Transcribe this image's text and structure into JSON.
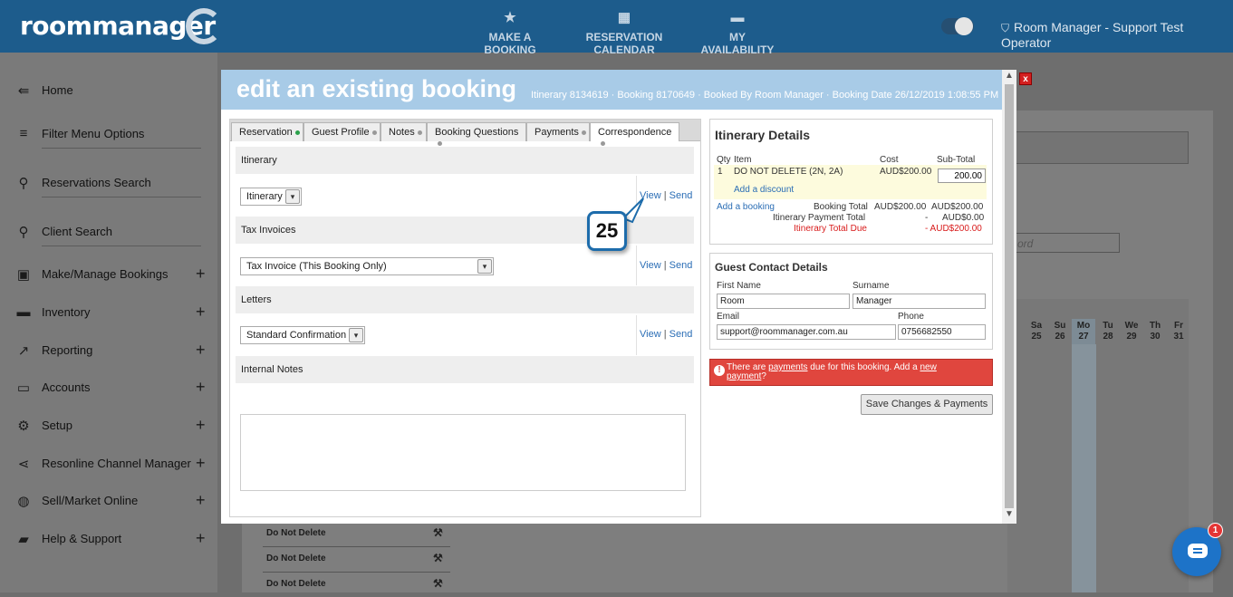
{
  "header": {
    "logo_text": "roommanager",
    "nav": [
      {
        "icon": "star-icon",
        "label": "MAKE A BOOKING"
      },
      {
        "icon": "calendar-icon",
        "label": "RESERVATION CALENDAR"
      },
      {
        "icon": "bed-icon",
        "label": "MY AVAILABILITY"
      }
    ],
    "user_name": "Room Manager - Support Test Operator"
  },
  "sidebar": {
    "items": [
      {
        "icon": "arrow-left-icon",
        "label": "Home",
        "expandable": false
      },
      {
        "icon": "filter-icon",
        "label": "Filter Menu Options",
        "expandable": false
      },
      {
        "icon": "search-icon",
        "label": "Reservations Search",
        "expandable": false
      },
      {
        "icon": "search-icon",
        "label": "Client Search",
        "expandable": false
      },
      {
        "icon": "calendar-check-icon",
        "label": "Make/Manage Bookings",
        "expandable": true
      },
      {
        "icon": "bed-icon",
        "label": "Inventory",
        "expandable": true
      },
      {
        "icon": "trend-icon",
        "label": "Reporting",
        "expandable": true
      },
      {
        "icon": "card-icon",
        "label": "Accounts",
        "expandable": true
      },
      {
        "icon": "gear-icon",
        "label": "Setup",
        "expandable": true
      },
      {
        "icon": "share-icon",
        "label": "Resonline Channel Manager",
        "expandable": true
      },
      {
        "icon": "globe-icon",
        "label": "Sell/Market Online",
        "expandable": true
      },
      {
        "icon": "chat-icon",
        "label": "Help & Support",
        "expandable": true
      }
    ],
    "expand_symbol": "+"
  },
  "background": {
    "search_placeholder": "ord",
    "days": [
      {
        "dow": "Sa",
        "num": "25"
      },
      {
        "dow": "Su",
        "num": "26"
      },
      {
        "dow": "Mo",
        "num": "27"
      },
      {
        "dow": "Tu",
        "num": "28"
      },
      {
        "dow": "We",
        "num": "29"
      },
      {
        "dow": "Th",
        "num": "30"
      },
      {
        "dow": "Fr",
        "num": "31"
      }
    ],
    "rows": [
      "Do Not Delete",
      "Do Not Delete",
      "Do Not Delete"
    ]
  },
  "modal": {
    "title": "edit an existing booking",
    "info": "Itinerary 8134619 · Booking 8170649 · Booked By Room Manager · Booking Date 26/12/2019 1:08:55 PM",
    "close": "x",
    "tabs": [
      {
        "label": "Reservation",
        "status": "green"
      },
      {
        "label": "Guest Profile",
        "status": "grey"
      },
      {
        "label": "Notes",
        "status": "grey"
      },
      {
        "label": "Booking Questions",
        "status": "grey"
      },
      {
        "label": "Payments",
        "status": "grey"
      },
      {
        "label": "Correspondence",
        "status": "grey",
        "active": true
      }
    ],
    "correspondence": {
      "itinerary_heading": "Itinerary",
      "itinerary_select": "Itinerary",
      "tax_heading": "Tax Invoices",
      "tax_select": "Tax Invoice (This Booking Only)",
      "letters_heading": "Letters",
      "letters_select": "Standard Confirmation",
      "notes_heading": "Internal Notes",
      "notes_value": "",
      "view": "View",
      "send": "Send",
      "sep": "|"
    },
    "callout_number": "25",
    "itinerary_details": {
      "title": "Itinerary Details",
      "col_qty": "Qty",
      "col_item": "Item",
      "col_cost": "Cost",
      "col_subtotal": "Sub-Total",
      "item_qty": "1",
      "item_name": "DO NOT DELETE (2N, 2A)",
      "item_cost": "AUD$200.00",
      "item_subtotal": "200.00",
      "add_discount": "Add a discount",
      "add_booking": "Add a booking",
      "booking_total_label": "Booking Total",
      "booking_total_cost": "AUD$200.00",
      "booking_total_sub": "AUD$200.00",
      "payment_total_label": "Itinerary Payment Total",
      "payment_total_cost": "-",
      "payment_total_sub": "AUD$0.00",
      "due_label": "Itinerary Total Due",
      "due_value": "- AUD$200.00"
    },
    "guest": {
      "title": "Guest Contact Details",
      "first_label": "First Name",
      "first_value": "Room",
      "surname_label": "Surname",
      "surname_value": "Manager",
      "email_label": "Email",
      "email_value": "support@roommanager.com.au",
      "phone_label": "Phone",
      "phone_value": "0756682550"
    },
    "alert": {
      "pre": "There are ",
      "link1": "payments",
      "mid": " due for this booking. Add a ",
      "link2a": "new",
      "link2b": "payment",
      "post": "?"
    },
    "save_button": "Save Changes & Payments"
  },
  "chat": {
    "badge": "1"
  }
}
